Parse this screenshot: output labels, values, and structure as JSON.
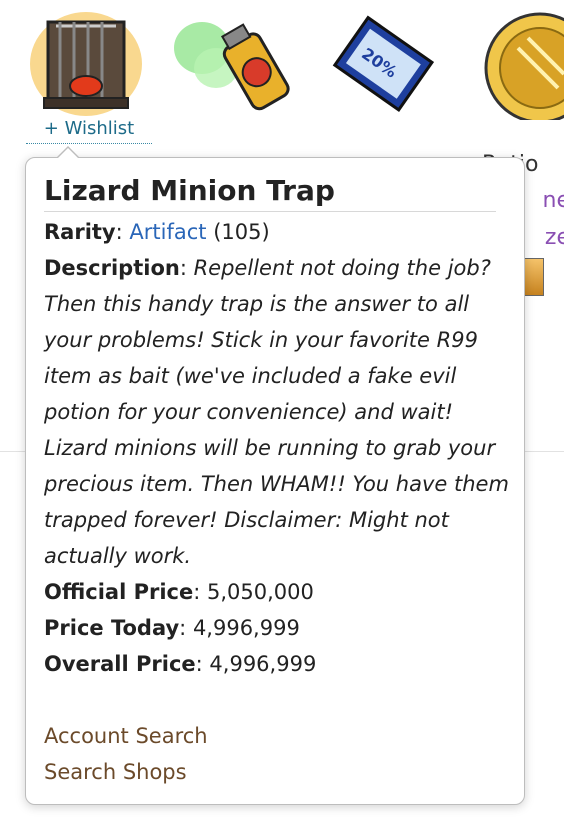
{
  "wishlist_label": "+ Wishlist",
  "peek": {
    "col4_top": "Ratio",
    "col4_line1": "ne",
    "col4_line2": "ze"
  },
  "popover": {
    "title": "Lizard Minion Trap",
    "rarity_label": "Rarity",
    "rarity_value": "Artifact",
    "rarity_number": "(105)",
    "description_label": "Description",
    "description_text": "Repellent not doing the job? Then this handy trap is the answer to all your problems! Stick in your favorite R99 item as bait (we've included a fake evil potion for your convenience) and wait! Lizard minions will be running to grab your precious item. Then WHAM!! You have them trapped forever! Disclaimer: Might not actually work.",
    "official_price_label": "Official Price",
    "official_price_value": "5,050,000",
    "price_today_label": "Price Today",
    "price_today_value": "4,996,999",
    "overall_price_label": "Overall Price",
    "overall_price_value": "4,996,999",
    "links": [
      "Account Search",
      "Search Shops"
    ]
  },
  "icons": {
    "item1": "lizard-trap-icon",
    "item2": "spray-can-icon",
    "item3": "discount-coupon-icon",
    "item4": "gold-coin-icon"
  },
  "colors": {
    "wishlist": "#1d6b89",
    "rarity_link": "#2a66b8",
    "footer_links": "#6b4a2a",
    "peek_purple": "#8a4fb3"
  }
}
